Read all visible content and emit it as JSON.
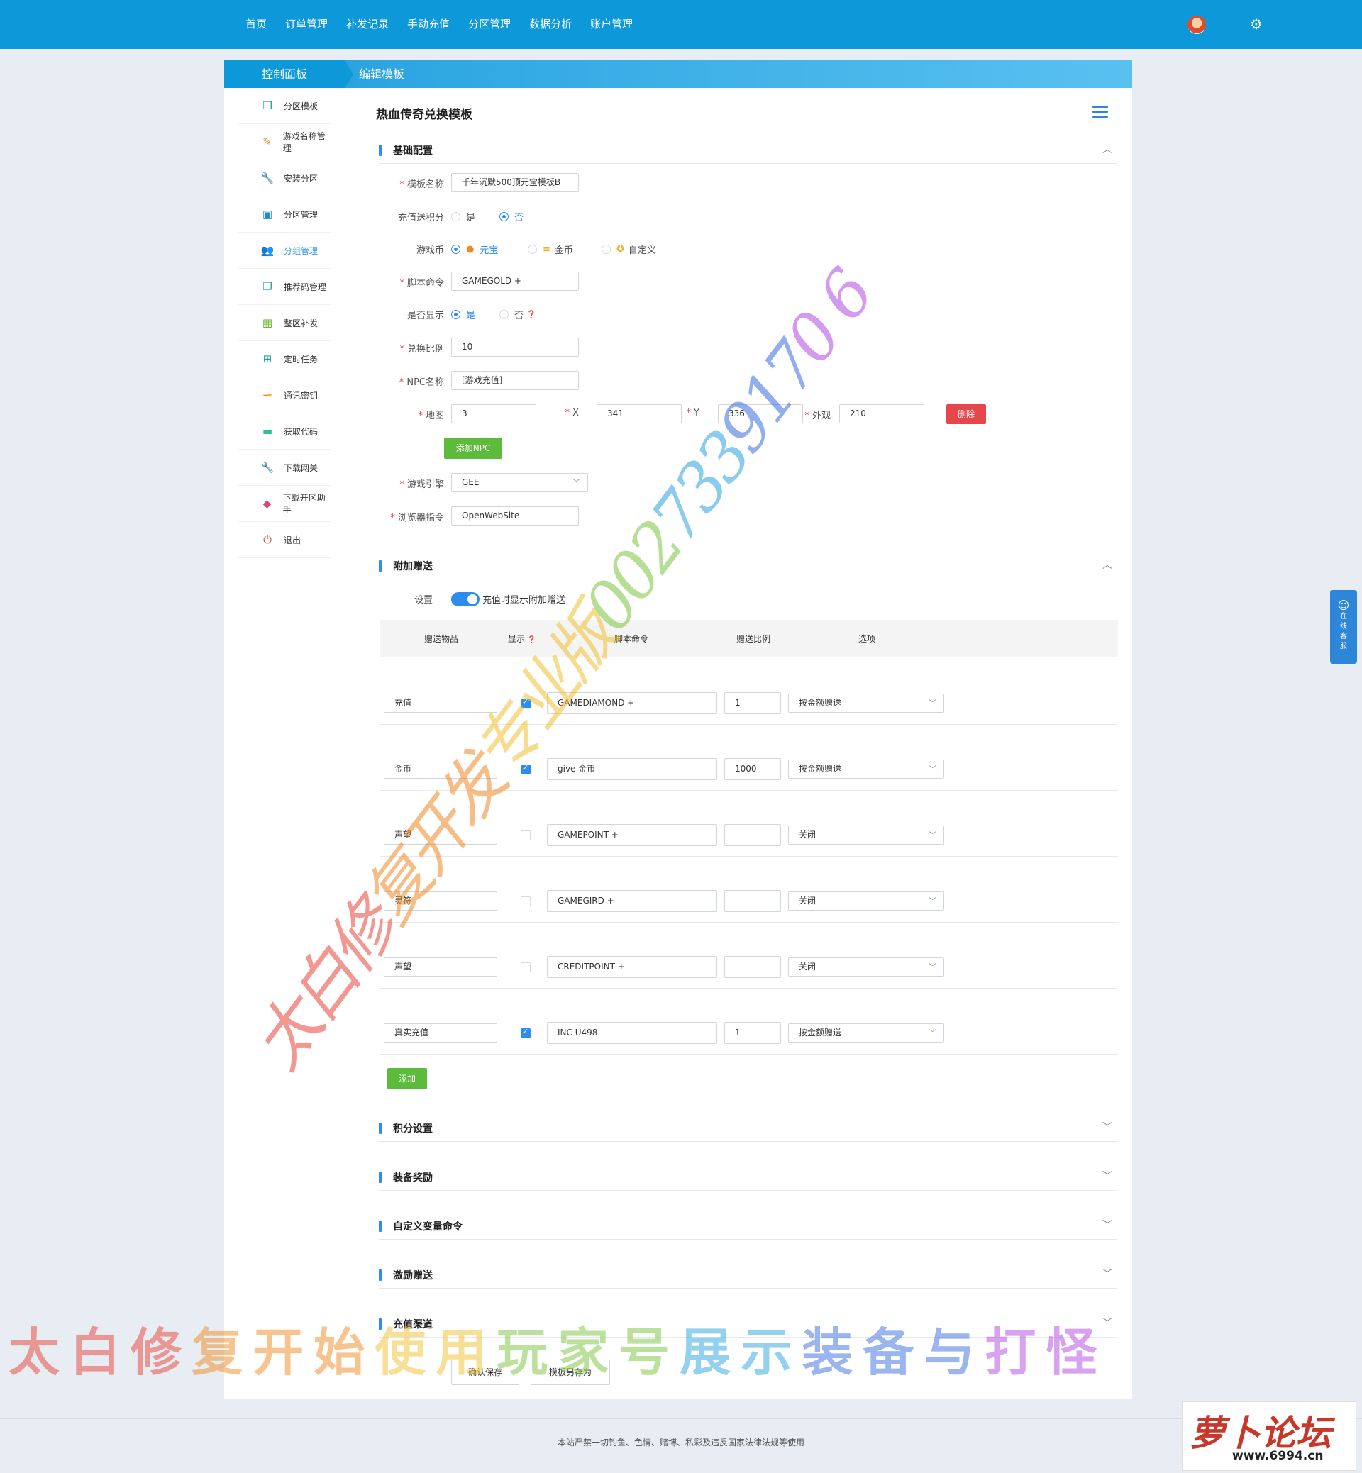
{
  "topnav": [
    "首页",
    "订单管理",
    "补发记录",
    "手动充值",
    "分区管理",
    "数据分析",
    "账户管理"
  ],
  "sidebar": {
    "title": "控制面板",
    "items": [
      {
        "label": "分区模板",
        "icon": "copy-icon",
        "color": "#1aa39a"
      },
      {
        "label": "游戏名称管理",
        "icon": "pencil-icon",
        "color": "#f08a24"
      },
      {
        "label": "安装分区",
        "icon": "wrench-icon",
        "color": "#57b21e"
      },
      {
        "label": "分区管理",
        "icon": "inbox-icon",
        "color": "#1f8ad6"
      },
      {
        "label": "分组管理",
        "icon": "users-icon",
        "color": "#57b21e",
        "active": true
      },
      {
        "label": "推荐码管理",
        "icon": "copy-icon",
        "color": "#1aa39a"
      },
      {
        "label": "整区补发",
        "icon": "calendar-icon",
        "color": "#57b21e"
      },
      {
        "label": "定时任务",
        "icon": "schedule-icon",
        "color": "#1aa39a"
      },
      {
        "label": "通讯密钥",
        "icon": "key-icon",
        "color": "#f08a24"
      },
      {
        "label": "获取代码",
        "icon": "briefcase-icon",
        "color": "#2bbf9a"
      },
      {
        "label": "下载网关",
        "icon": "wrench-icon",
        "color": "#57b21e"
      },
      {
        "label": "下载开区助手",
        "icon": "box-icon",
        "color": "#e0417f"
      },
      {
        "label": "退出",
        "icon": "power-icon",
        "color": "#e5474a"
      }
    ]
  },
  "main": {
    "tab": "编辑模板",
    "title": "热血传奇兑换模板"
  },
  "basic": {
    "section": "基础配置",
    "template_name": {
      "label": "模板名称",
      "value": "千年沉默500顶元宝模板B"
    },
    "points": {
      "label": "充值送积分",
      "yes": "是",
      "no": "否"
    },
    "currency": {
      "label": "游戏币",
      "opt1": "元宝",
      "opt2": "金币",
      "opt3": "自定义"
    },
    "script_cmd": {
      "label": "脚本命令",
      "value": "GAMEGOLD +"
    },
    "show": {
      "label": "是否显示",
      "yes": "是",
      "no": "否"
    },
    "ratio": {
      "label": "兑换比例",
      "value": "10"
    },
    "npc_name": {
      "label": "NPC名称",
      "value": "[游戏充值]"
    },
    "map": {
      "label": "地图",
      "value": "3"
    },
    "x": {
      "label": "X",
      "value": "341"
    },
    "y": {
      "label": "Y",
      "value": "336"
    },
    "look": {
      "label": "外观",
      "value": "210"
    },
    "delete_btn": "删除",
    "add_npc_btn": "添加NPC",
    "engine": {
      "label": "游戏引擎",
      "value": "GEE"
    },
    "browser_cmd": {
      "label": "浏览器指令",
      "value": "OpenWebSite"
    }
  },
  "extra": {
    "section": "附加赠送",
    "setting_label": "设置",
    "toggle_text": "充值时显示附加赠送",
    "headers": [
      "赠送物品",
      "显示",
      "脚本命令",
      "赠送比例",
      "选项"
    ],
    "rows": [
      {
        "item": "充值",
        "checked": true,
        "cmd": "GAMEDIAMOND +",
        "ratio": "1",
        "option": "按金额赠送"
      },
      {
        "item": "金币",
        "checked": true,
        "cmd": "give 金币",
        "ratio": "1000",
        "option": "按金额赠送"
      },
      {
        "item": "声望",
        "checked": false,
        "cmd": "GAMEPOINT +",
        "ratio": "",
        "option": "关闭"
      },
      {
        "item": "灵符",
        "checked": false,
        "cmd": "GAMEGIRD +",
        "ratio": "",
        "option": "关闭"
      },
      {
        "item": "声望",
        "checked": false,
        "cmd": "CREDITPOINT +",
        "ratio": "",
        "option": "关闭"
      },
      {
        "item": "真实充值",
        "checked": true,
        "cmd": "INC U498",
        "ratio": "1",
        "option": "按金额赠送"
      }
    ],
    "add_btn": "添加"
  },
  "sections": [
    "积分设置",
    "装备奖励",
    "自定义变量命令",
    "激励赠送",
    "充值渠道"
  ],
  "actions": {
    "save": "确认保存",
    "save_as": "模板另存为"
  },
  "footer": "本站严禁一切钓鱼、色情、赌博、私彩及违反国家法律法规等使用",
  "float_service": [
    "在",
    "线",
    "客",
    "服"
  ],
  "watermark1": "太白修复开发专业版0027339170 6",
  "watermark2": "太白修复开始使用玩家号展示装备与打怪",
  "logo": {
    "text": "萝卜论坛",
    "url": "www.6994.cn"
  }
}
